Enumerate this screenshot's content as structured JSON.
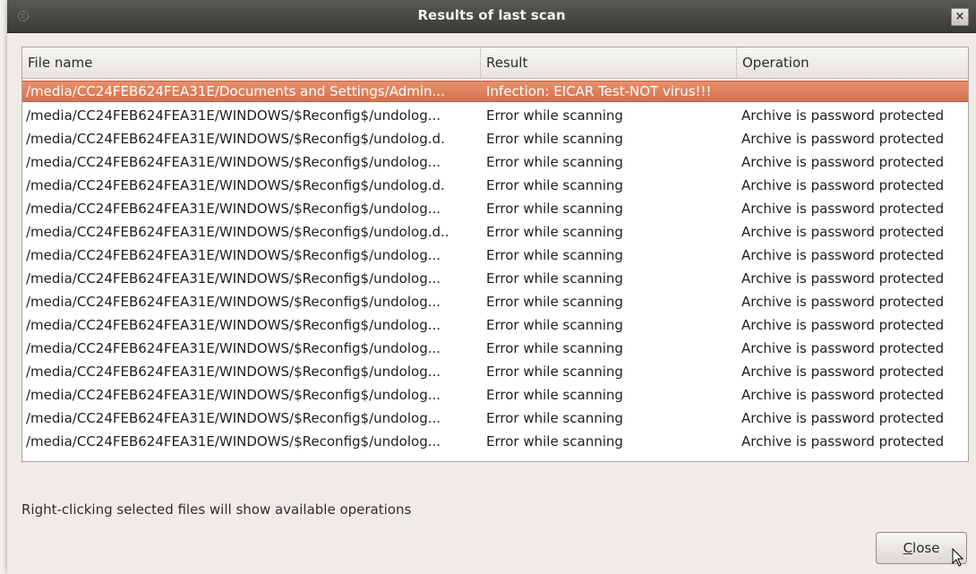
{
  "window": {
    "title": "Results of last scan",
    "close_glyph": "×",
    "corner_glyph": "c"
  },
  "table": {
    "columns": [
      "File name",
      "Result",
      "Operation"
    ],
    "rows": [
      {
        "file": "/media/CC24FEB624FEA31E/Documents and Settings/Admin...",
        "result": "Infection: EICAR Test-NOT virus!!!",
        "operation": "",
        "selected": true
      },
      {
        "file": "/media/CC24FEB624FEA31E/WINDOWS/$Reconfig$/undolog...",
        "result": "Error while scanning",
        "operation": "Archive is password protected"
      },
      {
        "file": "/media/CC24FEB624FEA31E/WINDOWS/$Reconfig$/undolog.d.",
        "result": "Error while scanning",
        "operation": "Archive is password protected"
      },
      {
        "file": "/media/CC24FEB624FEA31E/WINDOWS/$Reconfig$/undolog...",
        "result": "Error while scanning",
        "operation": "Archive is password protected"
      },
      {
        "file": "/media/CC24FEB624FEA31E/WINDOWS/$Reconfig$/undolog.d.",
        "result": "Error while scanning",
        "operation": "Archive is password protected"
      },
      {
        "file": "/media/CC24FEB624FEA31E/WINDOWS/$Reconfig$/undolog...",
        "result": "Error while scanning",
        "operation": "Archive is password protected"
      },
      {
        "file": "/media/CC24FEB624FEA31E/WINDOWS/$Reconfig$/undolog.d..",
        "result": "Error while scanning",
        "operation": "Archive is password protected"
      },
      {
        "file": "/media/CC24FEB624FEA31E/WINDOWS/$Reconfig$/undolog...",
        "result": "Error while scanning",
        "operation": "Archive is password protected"
      },
      {
        "file": "/media/CC24FEB624FEA31E/WINDOWS/$Reconfig$/undolog...",
        "result": "Error while scanning",
        "operation": "Archive is password protected"
      },
      {
        "file": "/media/CC24FEB624FEA31E/WINDOWS/$Reconfig$/undolog...",
        "result": "Error while scanning",
        "operation": "Archive is password protected"
      },
      {
        "file": "/media/CC24FEB624FEA31E/WINDOWS/$Reconfig$/undolog...",
        "result": "Error while scanning",
        "operation": "Archive is password protected"
      },
      {
        "file": "/media/CC24FEB624FEA31E/WINDOWS/$Reconfig$/undolog...",
        "result": "Error while scanning",
        "operation": "Archive is password protected"
      },
      {
        "file": "/media/CC24FEB624FEA31E/WINDOWS/$Reconfig$/undolog...",
        "result": "Error while scanning",
        "operation": "Archive is password protected"
      },
      {
        "file": "/media/CC24FEB624FEA31E/WINDOWS/$Reconfig$/undolog...",
        "result": "Error while scanning",
        "operation": "Archive is password protected"
      },
      {
        "file": "/media/CC24FEB624FEA31E/WINDOWS/$Reconfig$/undolog...",
        "result": "Error while scanning",
        "operation": "Archive is password protected"
      },
      {
        "file": "/media/CC24FEB624FEA31E/WINDOWS/$Reconfig$/undolog...",
        "result": "Error while scanning",
        "operation": "Archive is password protected"
      }
    ]
  },
  "hint_text": "Right-clicking selected files will show available operations",
  "buttons": {
    "close_label_mnemonic": "C",
    "close_label_rest": "lose"
  },
  "colors": {
    "selection": "#d97a55",
    "titlebar": "#3f3e3a"
  }
}
